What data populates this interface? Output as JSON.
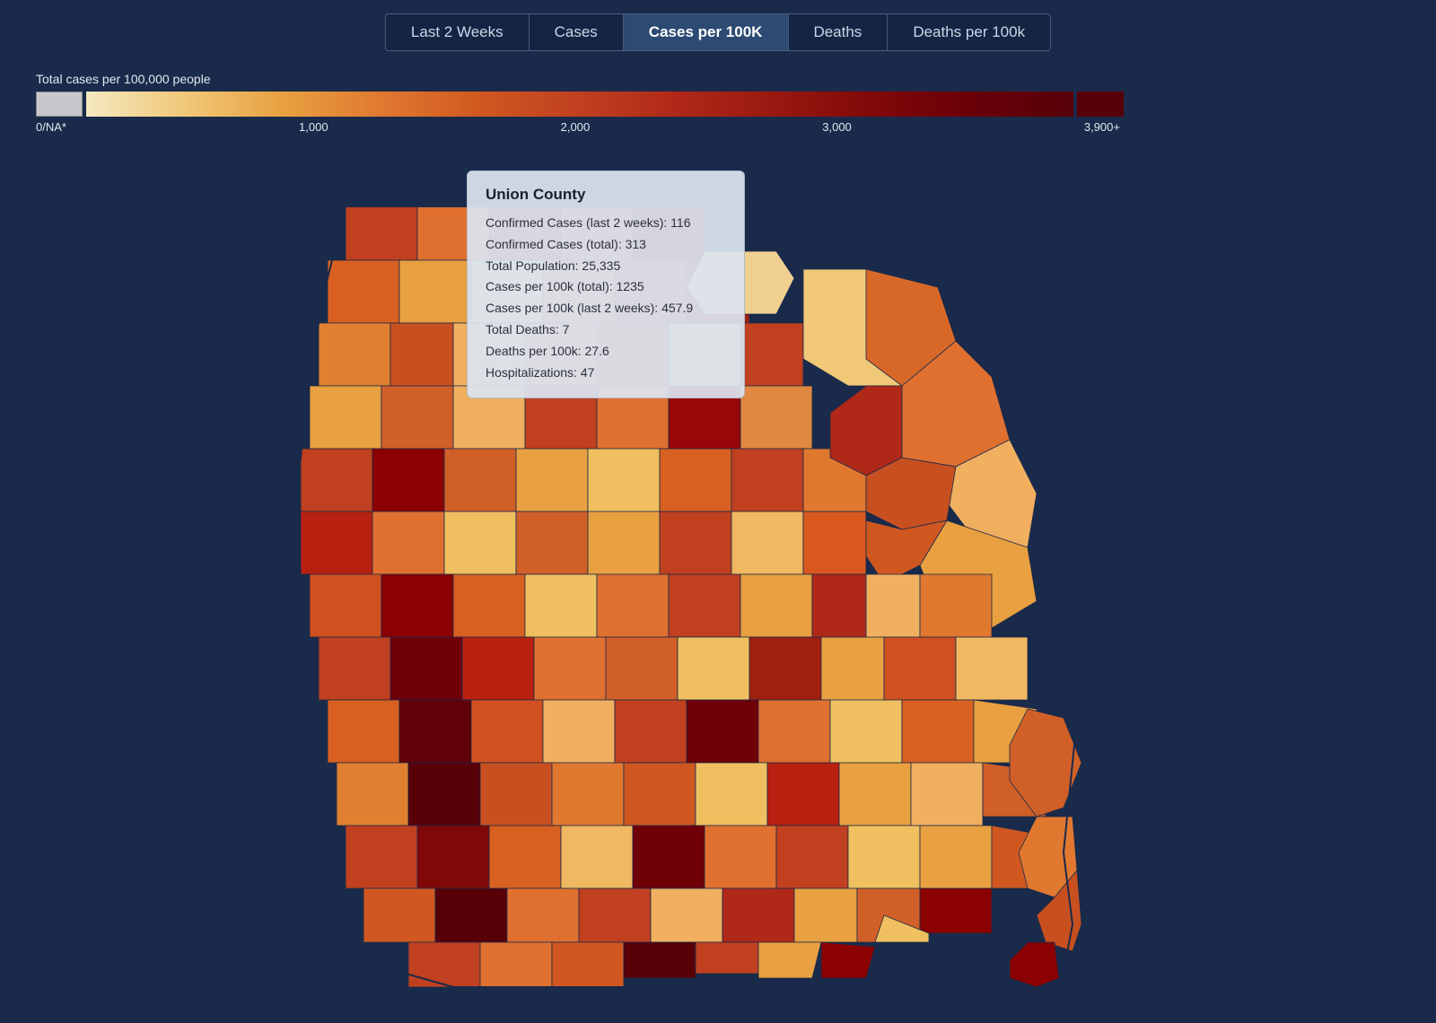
{
  "tabs": [
    {
      "label": "Last 2 Weeks",
      "active": false
    },
    {
      "label": "Cases",
      "active": false
    },
    {
      "label": "Cases per 100K",
      "active": true
    },
    {
      "label": "Deaths",
      "active": false
    },
    {
      "label": "Deaths per 100k",
      "active": false
    }
  ],
  "legend": {
    "title": "Total cases per 100,000 people",
    "labels": [
      "0/NA*",
      "1,000",
      "2,000",
      "3,000",
      "3,900+"
    ]
  },
  "tooltip": {
    "county_name": "Union County",
    "rows": [
      {
        "label": "Confirmed Cases (last 2 weeks): 116"
      },
      {
        "label": "Confirmed Cases (total): 313"
      },
      {
        "label": "Total Population: 25,335"
      },
      {
        "label": "Cases per 100k (total): 1235"
      },
      {
        "label": "Cases per 100k (last 2 weeks): 457.9"
      },
      {
        "label": "Total Deaths: 7"
      },
      {
        "label": "Deaths per 100k: 27.6"
      },
      {
        "label": "Hospitalizations: 47"
      }
    ]
  }
}
